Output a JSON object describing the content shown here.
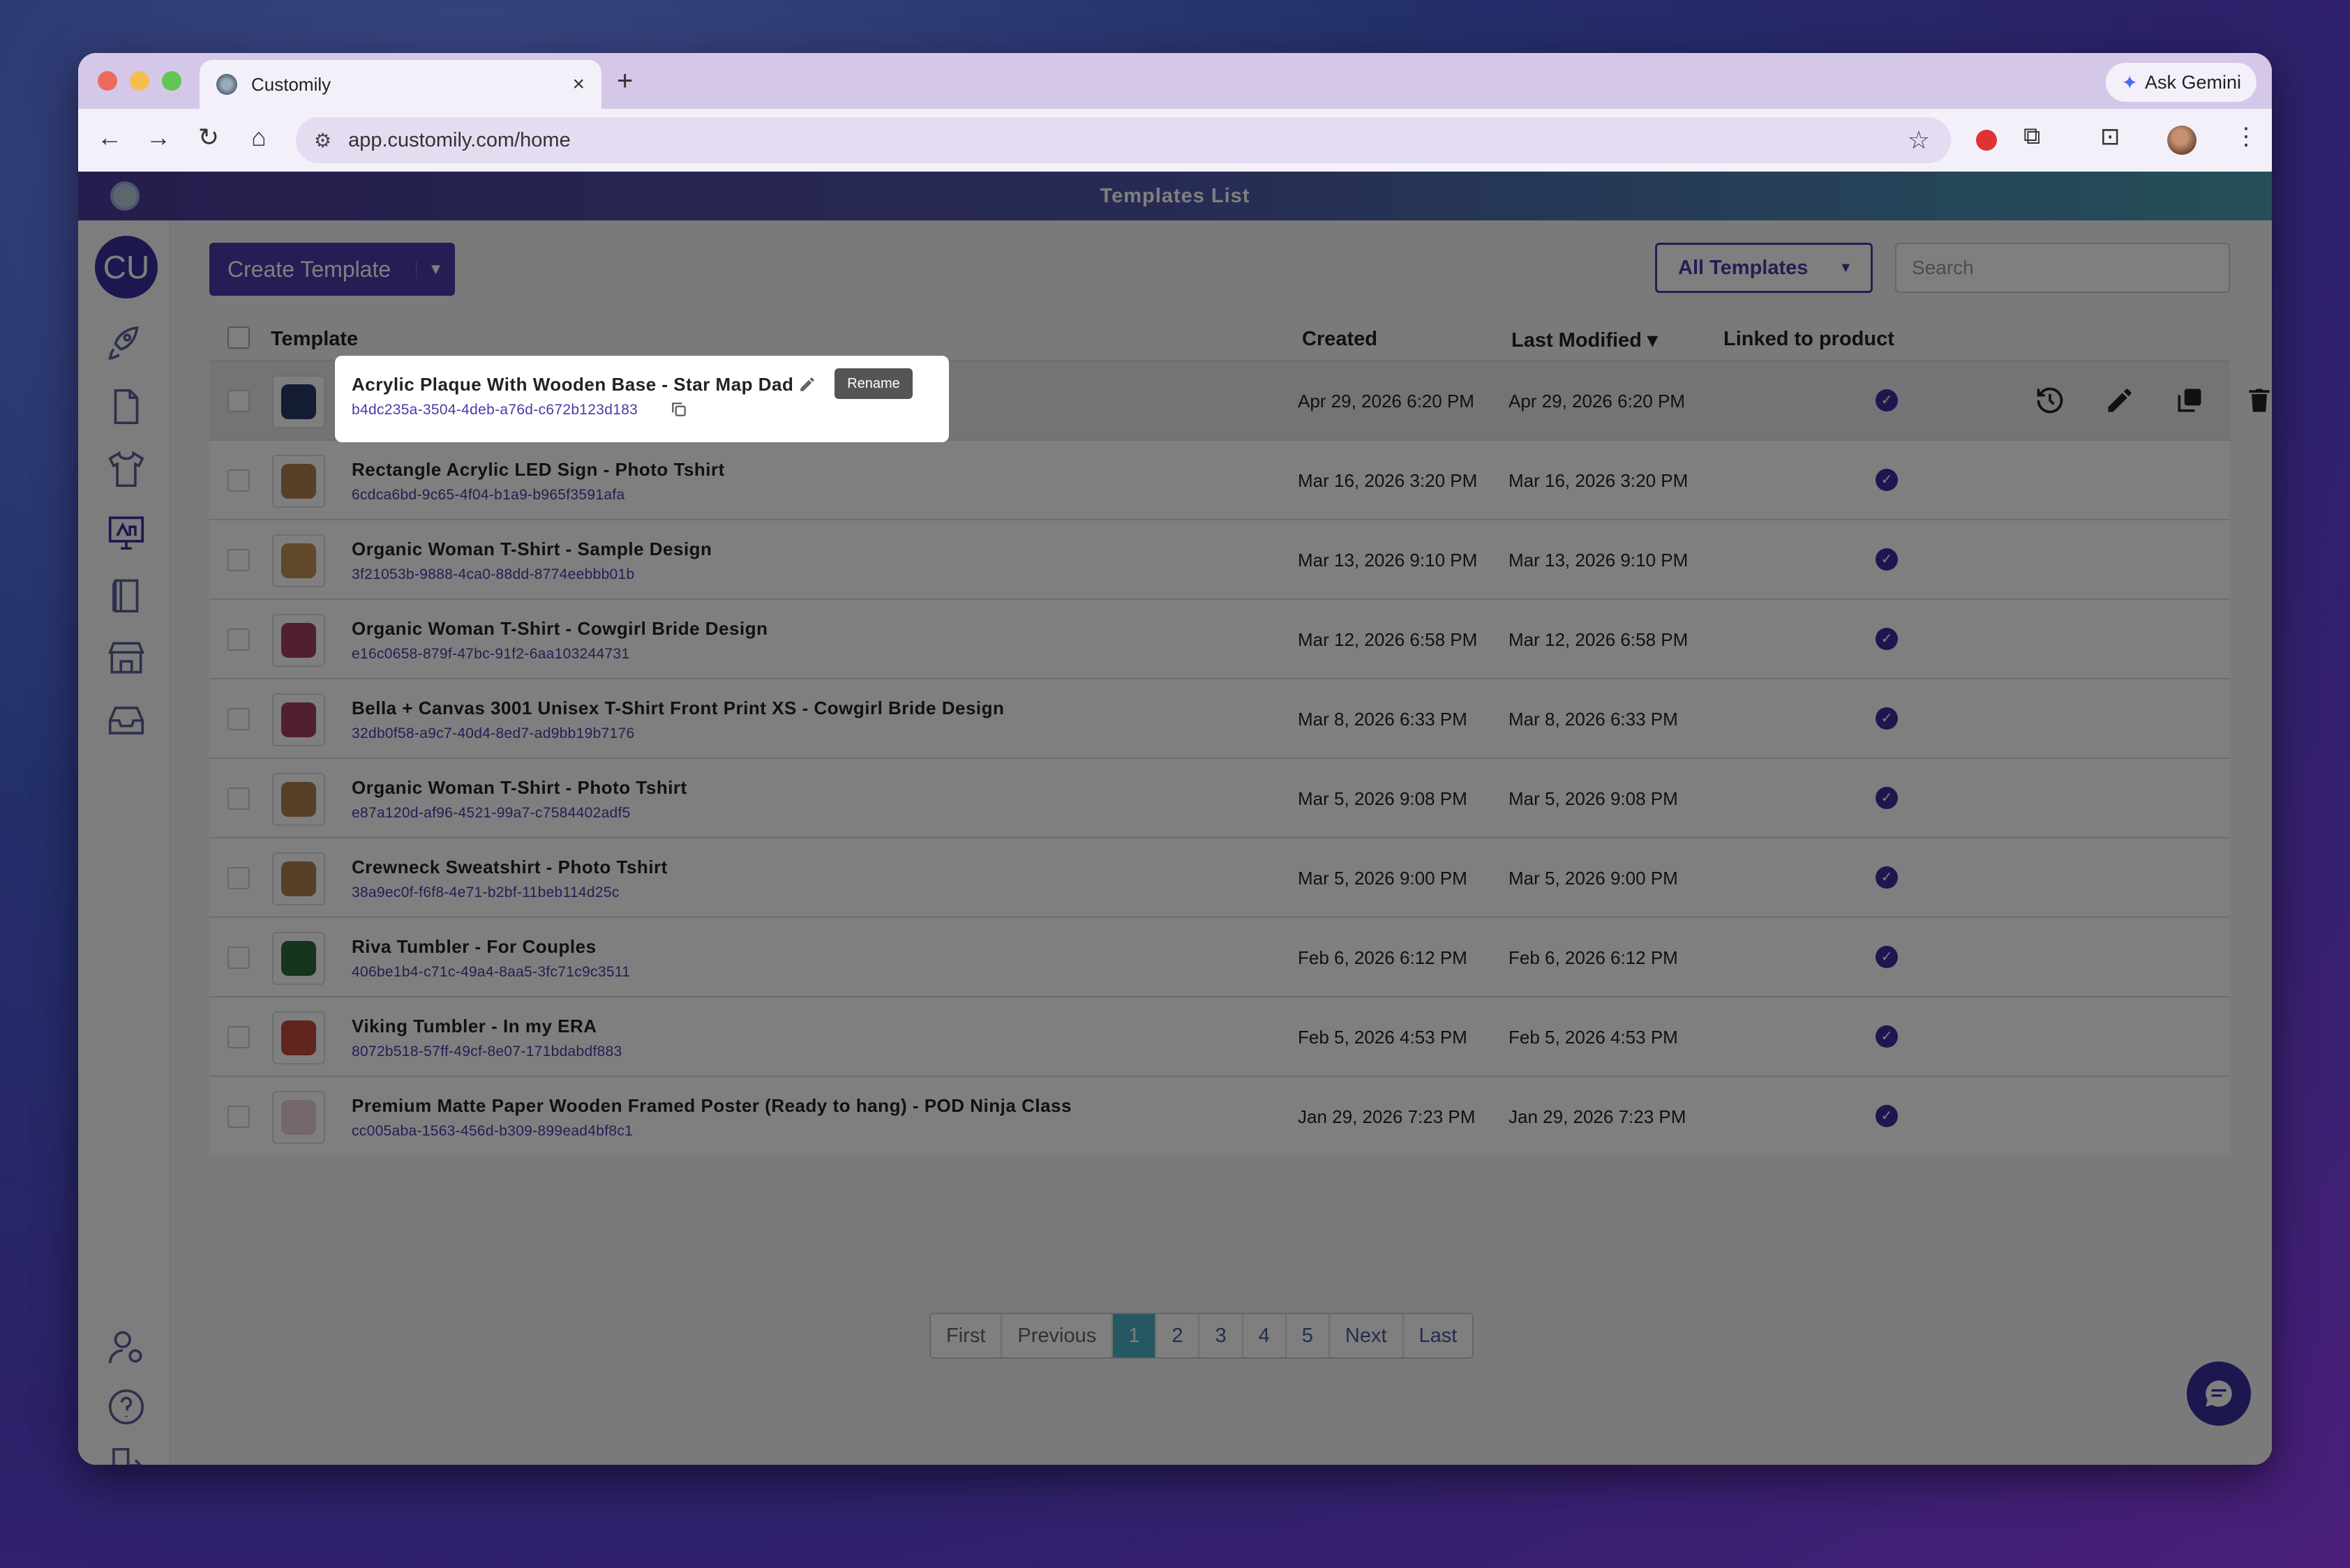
{
  "browser": {
    "tab_title": "Customily",
    "tab_close": "×",
    "new_tab": "+",
    "ask_gemini": "Ask Gemini",
    "url": "app.customily.com/home"
  },
  "app": {
    "header_title": "Templates List",
    "avatar_initials": "CU",
    "create_template_label": "Create Template",
    "all_templates_label": "All Templates",
    "search_placeholder": "Search"
  },
  "table": {
    "headers": {
      "template": "Template",
      "created": "Created",
      "last_modified": "Last Modified",
      "linked": "Linked to product"
    },
    "rename_label": "Rename",
    "rows": [
      {
        "name": "Acrylic Plaque With Wooden Base - Star Map Dad",
        "id": "b4dc235a-3504-4deb-a76d-c672b123d183",
        "created": "Apr 29, 2026 6:20 PM",
        "modified": "Apr 29, 2026 6:20 PM",
        "linked": true,
        "thumb_color": "#2a3a6a"
      },
      {
        "name": "Rectangle Acrylic LED Sign - Photo Tshirt",
        "id": "6cdca6bd-9c65-4f04-b1a9-b965f3591afa",
        "created": "Mar 16, 2026 3:20 PM",
        "modified": "Mar 16, 2026 3:20 PM",
        "linked": true,
        "thumb_color": "#b08050"
      },
      {
        "name": "Organic Woman T-Shirt - Sample Design",
        "id": "3f21053b-9888-4ca0-88dd-8774eebbb01b",
        "created": "Mar 13, 2026 9:10 PM",
        "modified": "Mar 13, 2026 9:10 PM",
        "linked": true,
        "thumb_color": "#c09050"
      },
      {
        "name": "Organic Woman T-Shirt - Cowgirl Bride Design",
        "id": "e16c0658-879f-47bc-91f2-6aa103244731",
        "created": "Mar 12, 2026 6:58 PM",
        "modified": "Mar 12, 2026 6:58 PM",
        "linked": true,
        "thumb_color": "#a04060"
      },
      {
        "name": "Bella + Canvas 3001 Unisex T-Shirt Front Print XS - Cowgirl Bride Design",
        "id": "32db0f58-a9c7-40d4-8ed7-ad9bb19b7176",
        "created": "Mar 8, 2026 6:33 PM",
        "modified": "Mar 8, 2026 6:33 PM",
        "linked": true,
        "thumb_color": "#a04060"
      },
      {
        "name": "Organic Woman T-Shirt - Photo Tshirt",
        "id": "e87a120d-af96-4521-99a7-c7584402adf5",
        "created": "Mar 5, 2026 9:08 PM",
        "modified": "Mar 5, 2026 9:08 PM",
        "linked": true,
        "thumb_color": "#b08050"
      },
      {
        "name": "Crewneck Sweatshirt - Photo Tshirt",
        "id": "38a9ec0f-f6f8-4e71-b2bf-11beb114d25c",
        "created": "Mar 5, 2026 9:00 PM",
        "modified": "Mar 5, 2026 9:00 PM",
        "linked": true,
        "thumb_color": "#b08050"
      },
      {
        "name": "Riva Tumbler - For Couples",
        "id": "406be1b4-c71c-49a4-8aa5-3fc71c9c3511",
        "created": "Feb 6, 2026 6:12 PM",
        "modified": "Feb 6, 2026 6:12 PM",
        "linked": true,
        "thumb_color": "#2a6a3a"
      },
      {
        "name": "Viking Tumbler - In my ERA",
        "id": "8072b518-57ff-49cf-8e07-171bdabdf883",
        "created": "Feb 5, 2026 4:53 PM",
        "modified": "Feb 5, 2026 4:53 PM",
        "linked": true,
        "thumb_color": "#c04a3a"
      },
      {
        "name": "Premium Matte Paper Wooden Framed Poster (Ready to hang) - POD Ninja Class",
        "id": "cc005aba-1563-456d-b309-899ead4bf8c1",
        "created": "Jan 29, 2026 7:23 PM",
        "modified": "Jan 29, 2026 7:23 PM",
        "linked": true,
        "thumb_color": "#e8d0d8"
      }
    ]
  },
  "pagination": {
    "first": "First",
    "previous": "Previous",
    "pages": [
      "1",
      "2",
      "3",
      "4",
      "5"
    ],
    "current_page": "1",
    "next": "Next",
    "last": "Last"
  },
  "colors": {
    "brand": "#4a3aa8",
    "brand_dark": "#3b2fa0",
    "pager_active": "#4ab0c4"
  }
}
